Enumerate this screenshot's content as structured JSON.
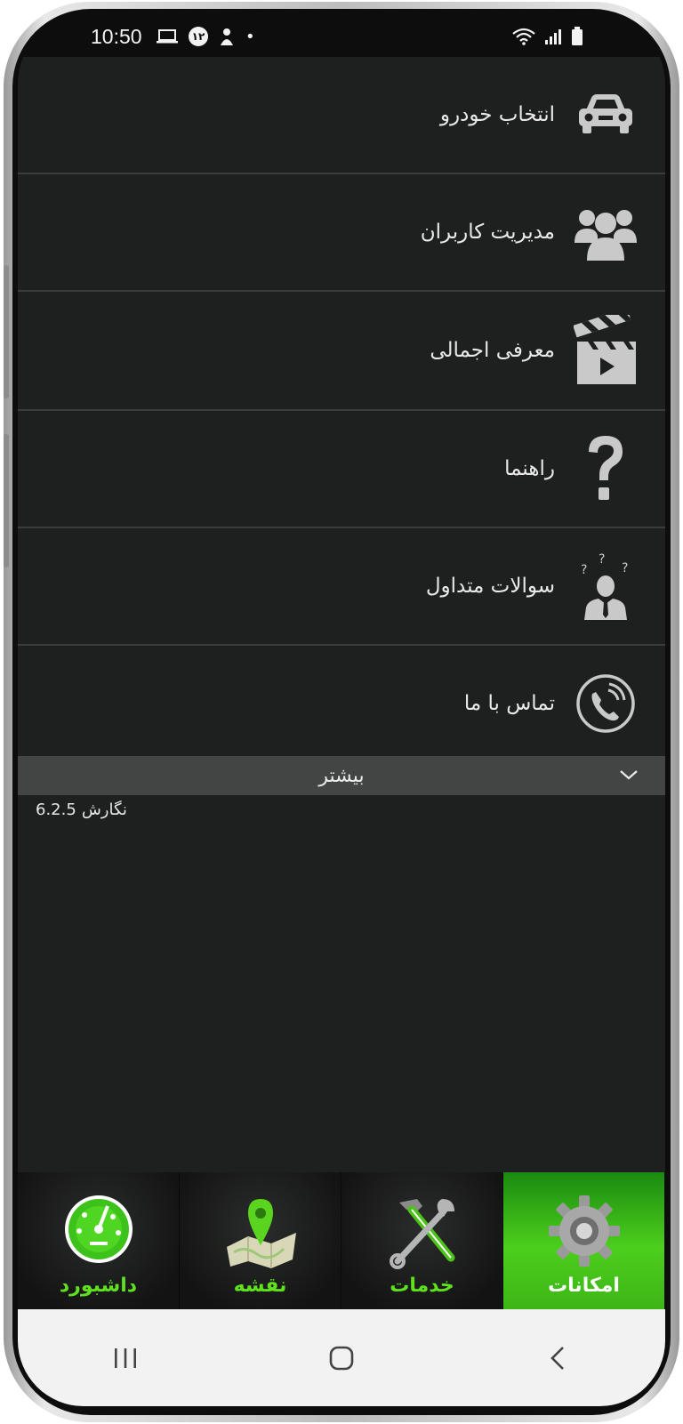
{
  "status_bar": {
    "time": "10:50",
    "notification_count": "۱۲",
    "dot": "•"
  },
  "menu": {
    "items": [
      {
        "label": "انتخاب خودرو",
        "icon": "car-icon"
      },
      {
        "label": "مدیریت کاربران",
        "icon": "users-icon"
      },
      {
        "label": "معرفی اجمالی",
        "icon": "clapperboard-icon"
      },
      {
        "label": "راهنما",
        "icon": "question-mark-icon"
      },
      {
        "label": "سوالات متداول",
        "icon": "faq-person-icon"
      },
      {
        "label": "تماس با ما",
        "icon": "phone-icon"
      }
    ]
  },
  "more": {
    "label": "بیشتر",
    "icon": "chevron-down-icon"
  },
  "version": {
    "label": "نگارش",
    "number": "6.2.5"
  },
  "tabs": [
    {
      "label": "داشبورد",
      "icon": "dashboard-gauge-icon",
      "active": false
    },
    {
      "label": "نقشه",
      "icon": "map-pin-icon",
      "active": false
    },
    {
      "label": "خدمات",
      "icon": "tools-icon",
      "active": false
    },
    {
      "label": "امکانات",
      "icon": "gear-icon",
      "active": true
    }
  ],
  "colors": {
    "background": "#1e201f",
    "accent_green": "#5fe11e",
    "active_tab": "#3db517",
    "text": "#e9e9e9",
    "icon_gray": "#c9c9c9"
  }
}
